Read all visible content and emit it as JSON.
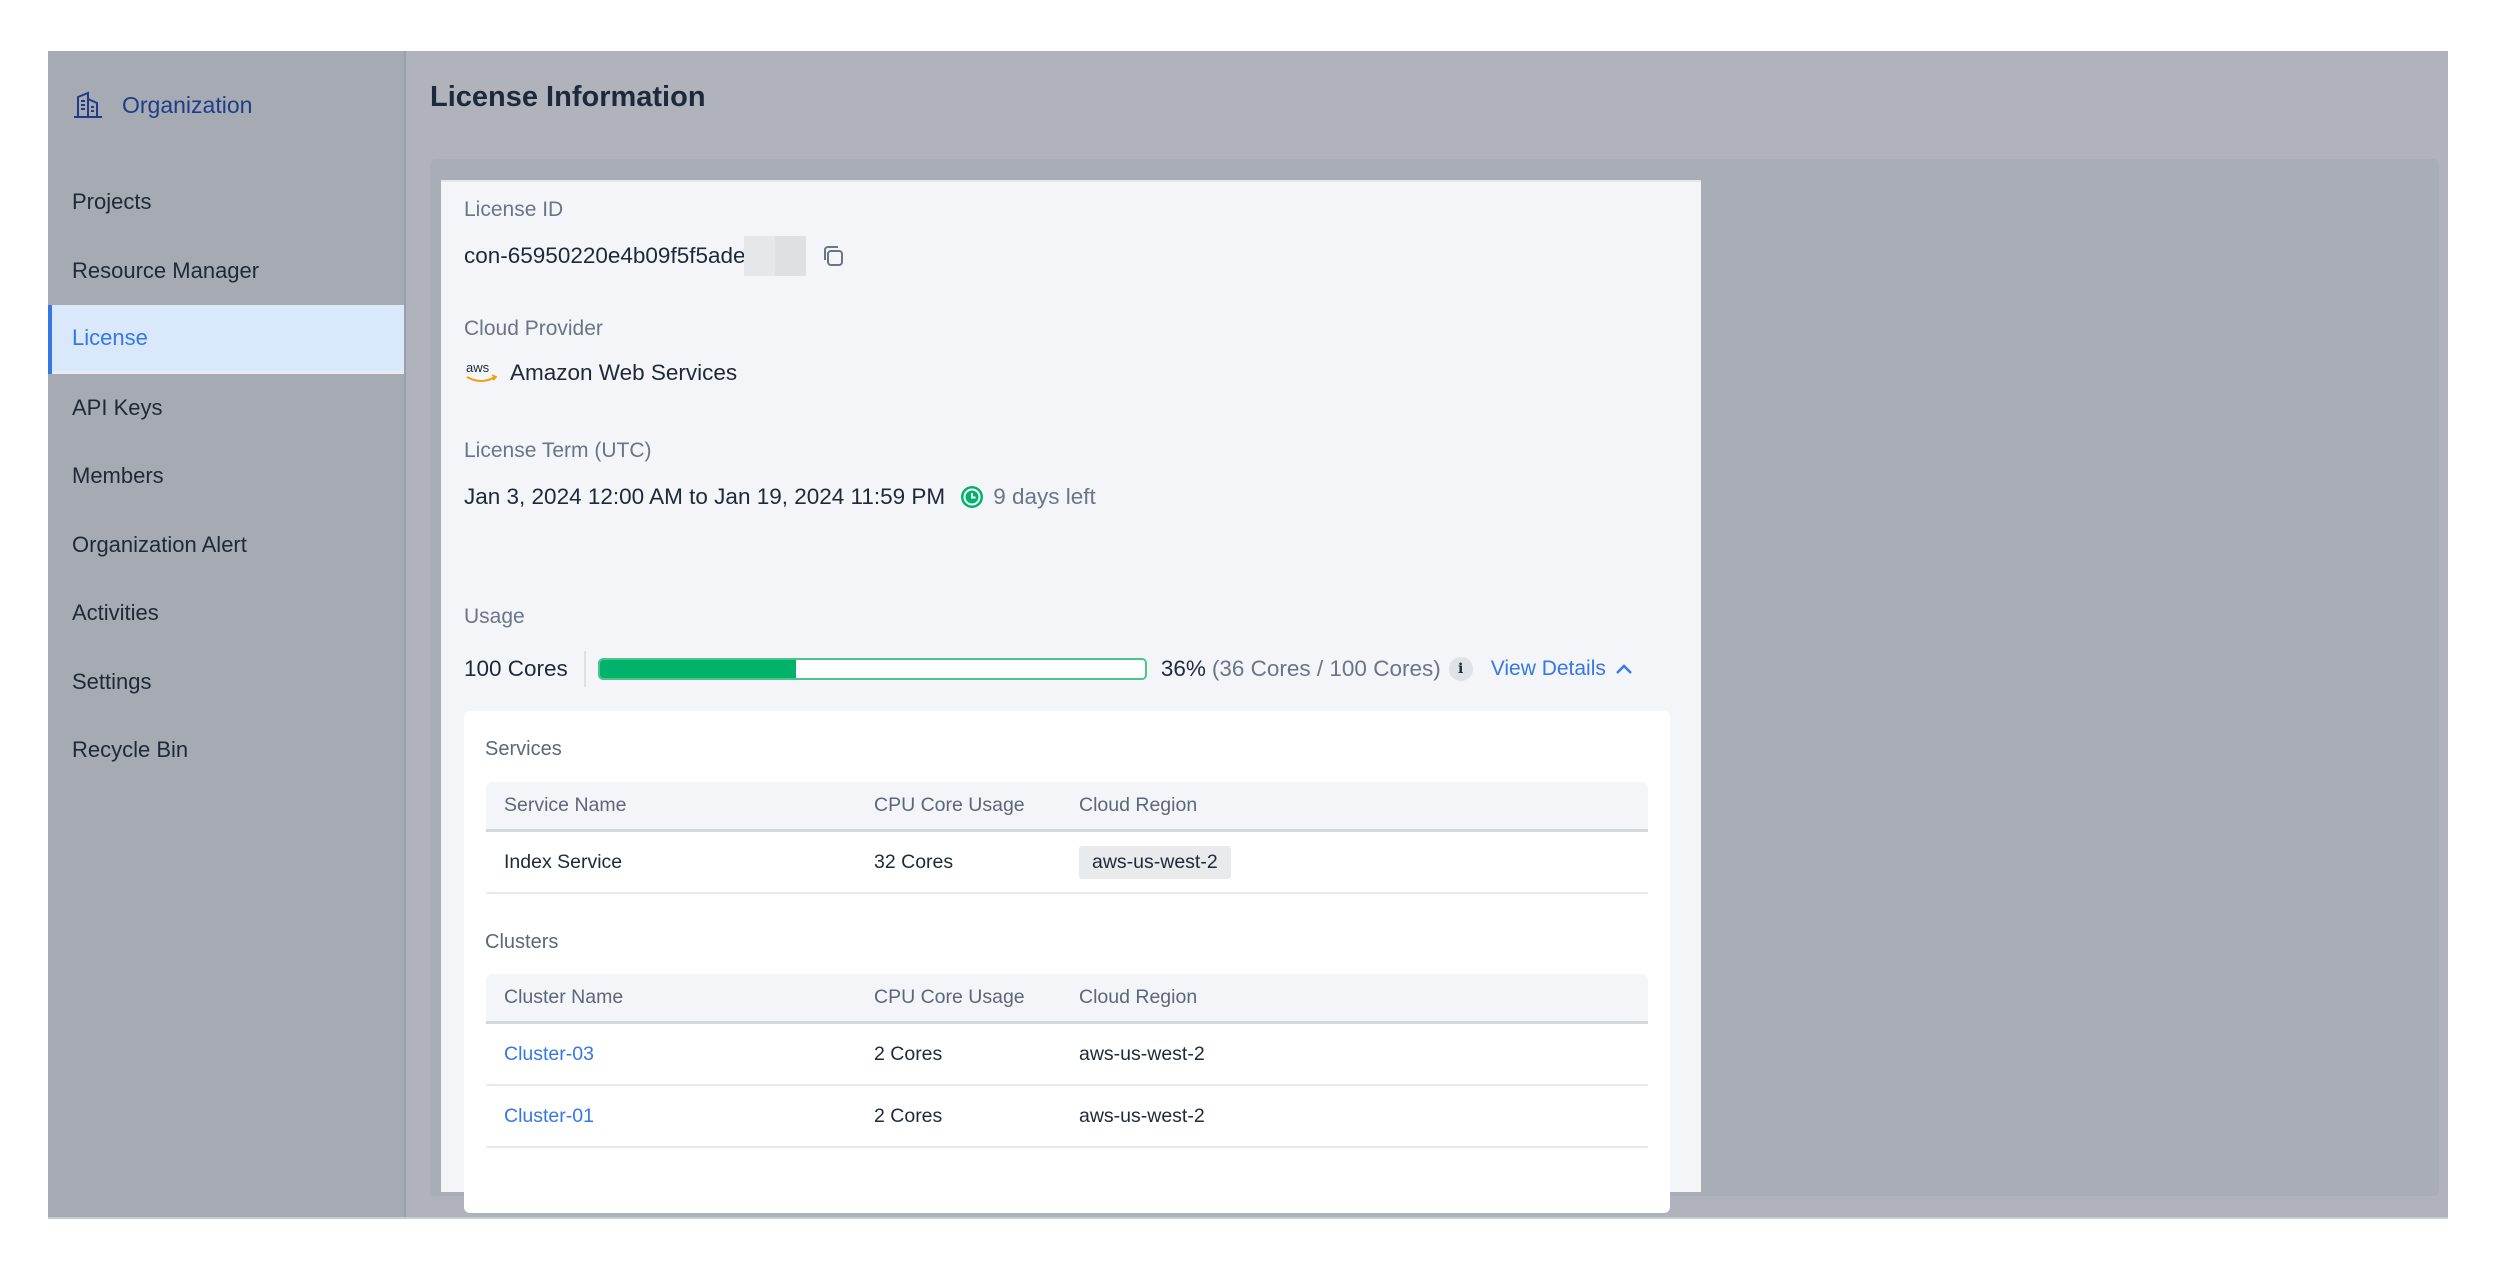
{
  "sidebar": {
    "org_title": "Organization",
    "items": [
      {
        "label": "Projects"
      },
      {
        "label": "Resource Manager"
      },
      {
        "label": "License",
        "active": true
      },
      {
        "label": "API Keys"
      },
      {
        "label": "Members"
      },
      {
        "label": "Organization Alert"
      },
      {
        "label": "Activities"
      },
      {
        "label": "Settings"
      },
      {
        "label": "Recycle Bin"
      }
    ]
  },
  "page": {
    "title": "License Information"
  },
  "license": {
    "id_label": "License ID",
    "id_value": "con-65950220e4b09f5f5ade",
    "provider_label": "Cloud Provider",
    "provider_icon_text": "aws",
    "provider_value": "Amazon Web Services",
    "term_label": "License Term (UTC)",
    "term_value": "Jan 3, 2024 12:00 AM to Jan 19, 2024 11:59 PM",
    "days_left": "9 days left",
    "usage_label": "Usage",
    "cores_total": "100 Cores",
    "usage_percent": 36,
    "usage_percent_text": "36%",
    "usage_detail": "(36 Cores / 100 Cores)",
    "info_icon_text": "i",
    "view_details": "View Details"
  },
  "services": {
    "title": "Services",
    "columns": [
      "Service Name",
      "CPU Core Usage",
      "Cloud Region"
    ],
    "rows": [
      {
        "name": "Index Service",
        "usage": "32 Cores",
        "region": "aws-us-west-2"
      }
    ]
  },
  "clusters": {
    "title": "Clusters",
    "columns": [
      "Cluster Name",
      "CPU Core Usage",
      "Cloud Region"
    ],
    "rows": [
      {
        "name": "Cluster-03",
        "usage": "2 Cores",
        "region": "aws-us-west-2"
      },
      {
        "name": "Cluster-01",
        "usage": "2 Cores",
        "region": "aws-us-west-2"
      }
    ]
  },
  "colors": {
    "accent": "#3578e5",
    "progress": "#00b36b",
    "org_title": "#1f3c88"
  }
}
